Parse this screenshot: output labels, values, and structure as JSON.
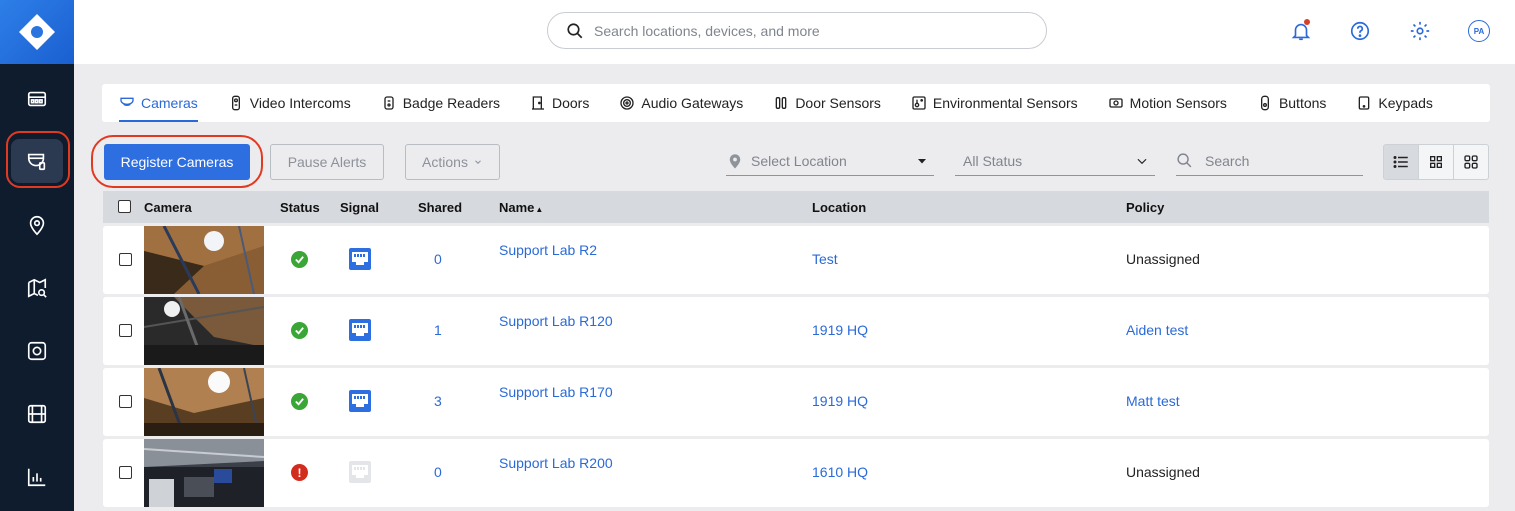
{
  "topbar": {
    "search_placeholder": "Search locations, devices, and more",
    "avatar_initials": "PA"
  },
  "tabs": [
    {
      "label": "Cameras",
      "icon": "camera-icon",
      "active": true
    },
    {
      "label": "Video Intercoms",
      "icon": "intercom-icon"
    },
    {
      "label": "Badge Readers",
      "icon": "badge-reader-icon"
    },
    {
      "label": "Doors",
      "icon": "door-icon"
    },
    {
      "label": "Audio Gateways",
      "icon": "audio-gateway-icon"
    },
    {
      "label": "Door Sensors",
      "icon": "door-sensor-icon"
    },
    {
      "label": "Environmental Sensors",
      "icon": "environmental-sensor-icon"
    },
    {
      "label": "Motion Sensors",
      "icon": "motion-sensor-icon"
    },
    {
      "label": "Buttons",
      "icon": "button-device-icon"
    },
    {
      "label": "Keypads",
      "icon": "keypad-icon"
    }
  ],
  "toolbar": {
    "register_label": "Register Cameras",
    "pause_label": "Pause Alerts",
    "actions_label": "Actions",
    "location_placeholder": "Select Location",
    "status_value": "All Status",
    "search_placeholder": "Search"
  },
  "table": {
    "headers": {
      "camera": "Camera",
      "status": "Status",
      "signal": "Signal",
      "shared": "Shared",
      "name": "Name",
      "location": "Location",
      "policy": "Policy"
    },
    "rows": [
      {
        "name": "Support Lab R2",
        "status": "online",
        "signal": "wired",
        "shared": "0",
        "location": "Test",
        "policy": "Unassigned",
        "policy_link": false
      },
      {
        "name": "Support Lab R120",
        "status": "online",
        "signal": "wired",
        "shared": "1",
        "location": "1919 HQ",
        "policy": "Aiden test",
        "policy_link": true
      },
      {
        "name": "Support Lab R170",
        "status": "online",
        "signal": "wired",
        "shared": "3",
        "location": "1919 HQ",
        "policy": "Matt test",
        "policy_link": true
      },
      {
        "name": "Support Lab R200",
        "status": "error",
        "signal": "none",
        "shared": "0",
        "location": "1610 HQ",
        "policy": "Unassigned",
        "policy_link": false
      }
    ]
  },
  "colors": {
    "accent": "#2a6ad8",
    "nav_bg": "#0f1c2e",
    "status_ok": "#3aa635",
    "status_error": "#d22c1f",
    "highlight_ring": "#e23a22"
  }
}
